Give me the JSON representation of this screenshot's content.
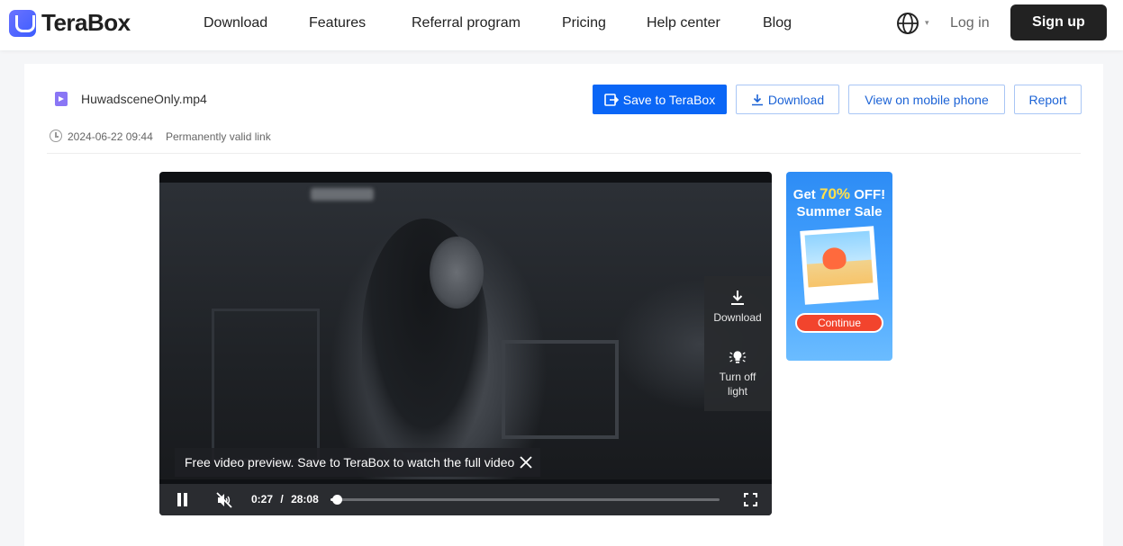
{
  "header": {
    "brand": "TeraBox",
    "nav": [
      {
        "label": "Download"
      },
      {
        "label": "Features"
      },
      {
        "label": "Referral program"
      },
      {
        "label": "Pricing"
      },
      {
        "label": "Help center"
      },
      {
        "label": "Blog"
      }
    ],
    "language_icon": "globe-icon",
    "login": "Log in",
    "signup": "Sign up"
  },
  "file": {
    "name": "HuwadsceneOnly.mp4",
    "date": "2024-06-22 09:44",
    "validity": "Permanently valid link"
  },
  "actions": {
    "save": "Save to TeraBox",
    "download": "Download",
    "mobile": "View on mobile phone",
    "report": "Report"
  },
  "player": {
    "side_download": "Download",
    "side_light": "Turn off light",
    "preview_notice": "Free video preview. Save to TeraBox to watch the full video",
    "current_time": "0:27",
    "separator": "/",
    "duration": "28:08",
    "progress": 0.016,
    "muted": true
  },
  "ad": {
    "line1_prefix": "Get",
    "line1_highlight": "70%",
    "line1_suffix": "OFF!",
    "line2": "Summer Sale",
    "button": "Continue"
  },
  "colors": {
    "primary": "#0a66f6",
    "signup_bg": "#222222",
    "ad_button": "#f2442d",
    "ad_highlight": "#ffe04a"
  }
}
